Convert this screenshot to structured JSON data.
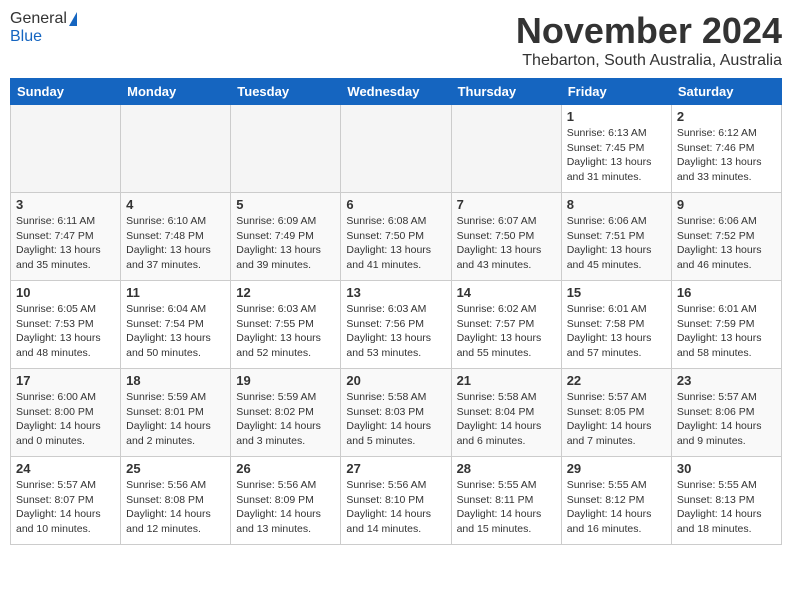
{
  "logo": {
    "general": "General",
    "blue": "Blue"
  },
  "title": "November 2024",
  "location": "Thebarton, South Australia, Australia",
  "days_of_week": [
    "Sunday",
    "Monday",
    "Tuesday",
    "Wednesday",
    "Thursday",
    "Friday",
    "Saturday"
  ],
  "weeks": [
    [
      {
        "day": "",
        "info": ""
      },
      {
        "day": "",
        "info": ""
      },
      {
        "day": "",
        "info": ""
      },
      {
        "day": "",
        "info": ""
      },
      {
        "day": "",
        "info": ""
      },
      {
        "day": "1",
        "info": "Sunrise: 6:13 AM\nSunset: 7:45 PM\nDaylight: 13 hours\nand 31 minutes."
      },
      {
        "day": "2",
        "info": "Sunrise: 6:12 AM\nSunset: 7:46 PM\nDaylight: 13 hours\nand 33 minutes."
      }
    ],
    [
      {
        "day": "3",
        "info": "Sunrise: 6:11 AM\nSunset: 7:47 PM\nDaylight: 13 hours\nand 35 minutes."
      },
      {
        "day": "4",
        "info": "Sunrise: 6:10 AM\nSunset: 7:48 PM\nDaylight: 13 hours\nand 37 minutes."
      },
      {
        "day": "5",
        "info": "Sunrise: 6:09 AM\nSunset: 7:49 PM\nDaylight: 13 hours\nand 39 minutes."
      },
      {
        "day": "6",
        "info": "Sunrise: 6:08 AM\nSunset: 7:50 PM\nDaylight: 13 hours\nand 41 minutes."
      },
      {
        "day": "7",
        "info": "Sunrise: 6:07 AM\nSunset: 7:50 PM\nDaylight: 13 hours\nand 43 minutes."
      },
      {
        "day": "8",
        "info": "Sunrise: 6:06 AM\nSunset: 7:51 PM\nDaylight: 13 hours\nand 45 minutes."
      },
      {
        "day": "9",
        "info": "Sunrise: 6:06 AM\nSunset: 7:52 PM\nDaylight: 13 hours\nand 46 minutes."
      }
    ],
    [
      {
        "day": "10",
        "info": "Sunrise: 6:05 AM\nSunset: 7:53 PM\nDaylight: 13 hours\nand 48 minutes."
      },
      {
        "day": "11",
        "info": "Sunrise: 6:04 AM\nSunset: 7:54 PM\nDaylight: 13 hours\nand 50 minutes."
      },
      {
        "day": "12",
        "info": "Sunrise: 6:03 AM\nSunset: 7:55 PM\nDaylight: 13 hours\nand 52 minutes."
      },
      {
        "day": "13",
        "info": "Sunrise: 6:03 AM\nSunset: 7:56 PM\nDaylight: 13 hours\nand 53 minutes."
      },
      {
        "day": "14",
        "info": "Sunrise: 6:02 AM\nSunset: 7:57 PM\nDaylight: 13 hours\nand 55 minutes."
      },
      {
        "day": "15",
        "info": "Sunrise: 6:01 AM\nSunset: 7:58 PM\nDaylight: 13 hours\nand 57 minutes."
      },
      {
        "day": "16",
        "info": "Sunrise: 6:01 AM\nSunset: 7:59 PM\nDaylight: 13 hours\nand 58 minutes."
      }
    ],
    [
      {
        "day": "17",
        "info": "Sunrise: 6:00 AM\nSunset: 8:00 PM\nDaylight: 14 hours\nand 0 minutes."
      },
      {
        "day": "18",
        "info": "Sunrise: 5:59 AM\nSunset: 8:01 PM\nDaylight: 14 hours\nand 2 minutes."
      },
      {
        "day": "19",
        "info": "Sunrise: 5:59 AM\nSunset: 8:02 PM\nDaylight: 14 hours\nand 3 minutes."
      },
      {
        "day": "20",
        "info": "Sunrise: 5:58 AM\nSunset: 8:03 PM\nDaylight: 14 hours\nand 5 minutes."
      },
      {
        "day": "21",
        "info": "Sunrise: 5:58 AM\nSunset: 8:04 PM\nDaylight: 14 hours\nand 6 minutes."
      },
      {
        "day": "22",
        "info": "Sunrise: 5:57 AM\nSunset: 8:05 PM\nDaylight: 14 hours\nand 7 minutes."
      },
      {
        "day": "23",
        "info": "Sunrise: 5:57 AM\nSunset: 8:06 PM\nDaylight: 14 hours\nand 9 minutes."
      }
    ],
    [
      {
        "day": "24",
        "info": "Sunrise: 5:57 AM\nSunset: 8:07 PM\nDaylight: 14 hours\nand 10 minutes."
      },
      {
        "day": "25",
        "info": "Sunrise: 5:56 AM\nSunset: 8:08 PM\nDaylight: 14 hours\nand 12 minutes."
      },
      {
        "day": "26",
        "info": "Sunrise: 5:56 AM\nSunset: 8:09 PM\nDaylight: 14 hours\nand 13 minutes."
      },
      {
        "day": "27",
        "info": "Sunrise: 5:56 AM\nSunset: 8:10 PM\nDaylight: 14 hours\nand 14 minutes."
      },
      {
        "day": "28",
        "info": "Sunrise: 5:55 AM\nSunset: 8:11 PM\nDaylight: 14 hours\nand 15 minutes."
      },
      {
        "day": "29",
        "info": "Sunrise: 5:55 AM\nSunset: 8:12 PM\nDaylight: 14 hours\nand 16 minutes."
      },
      {
        "day": "30",
        "info": "Sunrise: 5:55 AM\nSunset: 8:13 PM\nDaylight: 14 hours\nand 18 minutes."
      }
    ]
  ]
}
